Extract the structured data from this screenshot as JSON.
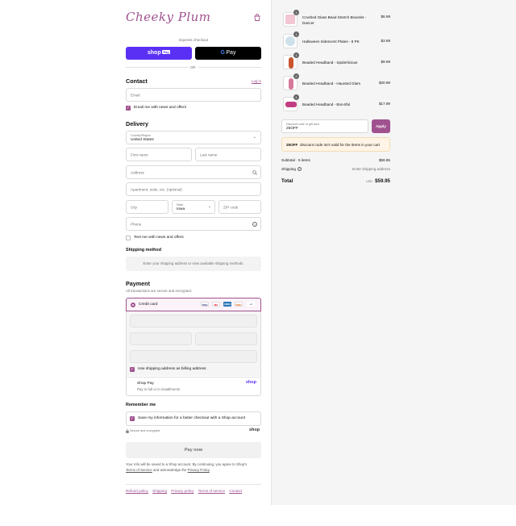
{
  "brand": {
    "logo_text": "Cheeky Plum"
  },
  "express": {
    "label": "Express checkout",
    "shop_pay": "shop",
    "shop_pay_badge": "Pay",
    "gpay_g": "G",
    "gpay": "Pay",
    "or": "OR"
  },
  "contact": {
    "title": "Contact",
    "login": "Log in",
    "email_placeholder": "Email",
    "news_label": "Email me with news and offers"
  },
  "delivery": {
    "title": "Delivery",
    "country_label": "Country/Region",
    "country_value": "United States",
    "first_name": "First name",
    "last_name": "Last name",
    "address": "Address",
    "apartment": "Apartment, suite, etc. (optional)",
    "city": "City",
    "state_label": "State",
    "state_value": "Iowa",
    "zip": "ZIP code",
    "phone": "Phone",
    "text_label": "Text me with news and offers"
  },
  "shipping_method": {
    "title": "Shipping method",
    "message": "Enter your shipping address to view available shipping methods."
  },
  "payment": {
    "title": "Payment",
    "subtitle": "All transactions are secure and encrypted.",
    "credit_card": "Credit card",
    "cards": [
      "VISA",
      "MC",
      "AMEX",
      "DISC",
      "+4"
    ],
    "billing_label": "Use shipping address as billing address",
    "shop_pay_title": "Shop Pay",
    "shop_pay_sub": "Pay in full or in installments",
    "shop_pay_logo": "shop"
  },
  "remember": {
    "title": "Remember me",
    "save_label": "Save my information for a faster checkout with a Shop account",
    "secure": "Secure and encrypted",
    "shop_logo": "shop"
  },
  "pay_button": "Pay now",
  "legal": {
    "line1": "Your info will be saved to a Shop account. By continuing, you agree to Shop's",
    "terms": "Terms of Service",
    "and": "and acknowledge the",
    "privacy": "Privacy Policy",
    "dot": "."
  },
  "footer_links": [
    "Refund policy",
    "Shipping",
    "Privacy policy",
    "Terms of service",
    "Contact"
  ],
  "cart": {
    "items": [
      {
        "name": "Crushed Glass Bead Stretch Bracelet - Dancer",
        "price": "$6.99",
        "qty": "1",
        "color": "#f2c6d2"
      },
      {
        "name": "Halloween Iridescent Plates - 8 PK",
        "price": "$3.99",
        "qty": "1",
        "color": "#cfe1ea"
      },
      {
        "name": "Beaded Headband - Spiderlicious",
        "price": "$9.99",
        "qty": "1",
        "color": "#c9552e"
      },
      {
        "name": "Beaded Headband - Haunted Glam",
        "price": "$20.99",
        "qty": "2",
        "color": "#d6799a"
      },
      {
        "name": "Beaded Headband - Boo-tiful",
        "price": "$17.99",
        "qty": "1",
        "color": "#c23d82"
      }
    ],
    "discount_label": "Discount code or gift card",
    "discount_value": "25OFF",
    "apply": "Apply",
    "notice_code": "25OFF",
    "notice_text": "discount code isn't valid for the items in your cart",
    "subtotal_label": "Subtotal · 5 items",
    "subtotal_value": "$59.95",
    "shipping_label": "Shipping",
    "shipping_value": "Enter shipping address",
    "total_label": "Total",
    "currency": "USD",
    "total_value": "$59.95"
  },
  "colors": {
    "accent": "#a0528f",
    "shop_purple": "#5a31f4"
  }
}
